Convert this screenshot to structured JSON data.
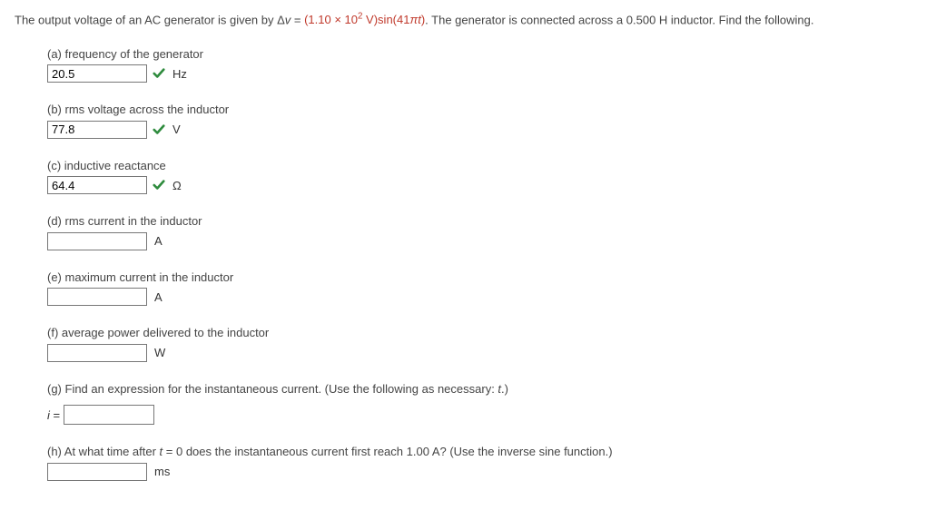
{
  "problem": {
    "prefix": "The output voltage of an AC generator is given by Δ",
    "var": "v",
    "eq": " = ",
    "highlight_open": "(1.10 × 10",
    "highlight_sup": "2",
    "highlight_mid": " V)sin(41",
    "highlight_pi": "π",
    "highlight_t": "t",
    "highlight_close": ")",
    "suffix": ". The generator is connected across a 0.500 H inductor. Find the following."
  },
  "parts": {
    "a": {
      "label": "(a) frequency of the generator",
      "value": "20.5",
      "unit": "Hz",
      "checked": true
    },
    "b": {
      "label": "(b) rms voltage across the inductor",
      "value": "77.8",
      "unit": "V",
      "checked": true
    },
    "c": {
      "label": "(c) inductive reactance",
      "value": "64.4",
      "unit": "Ω",
      "checked": true
    },
    "d": {
      "label": "(d) rms current in the inductor",
      "value": "",
      "unit": "A",
      "checked": false
    },
    "e": {
      "label": "(e) maximum current in the inductor",
      "value": "",
      "unit": "A",
      "checked": false
    },
    "f": {
      "label": "(f) average power delivered to the inductor",
      "value": "",
      "unit": "W",
      "checked": false
    },
    "g": {
      "label_pre": "(g) Find an expression for the instantaneous current. (Use the following as necessary: ",
      "label_var": "t",
      "label_post": ".)",
      "prefix_var": "i",
      "prefix_eq": " ="
    },
    "h": {
      "label_pre": "(h) At what time after ",
      "label_var": "t",
      "label_mid": " = 0 does the instantaneous current first reach 1.00 A? (Use the inverse sine function.)",
      "value": "",
      "unit": "ms"
    }
  }
}
